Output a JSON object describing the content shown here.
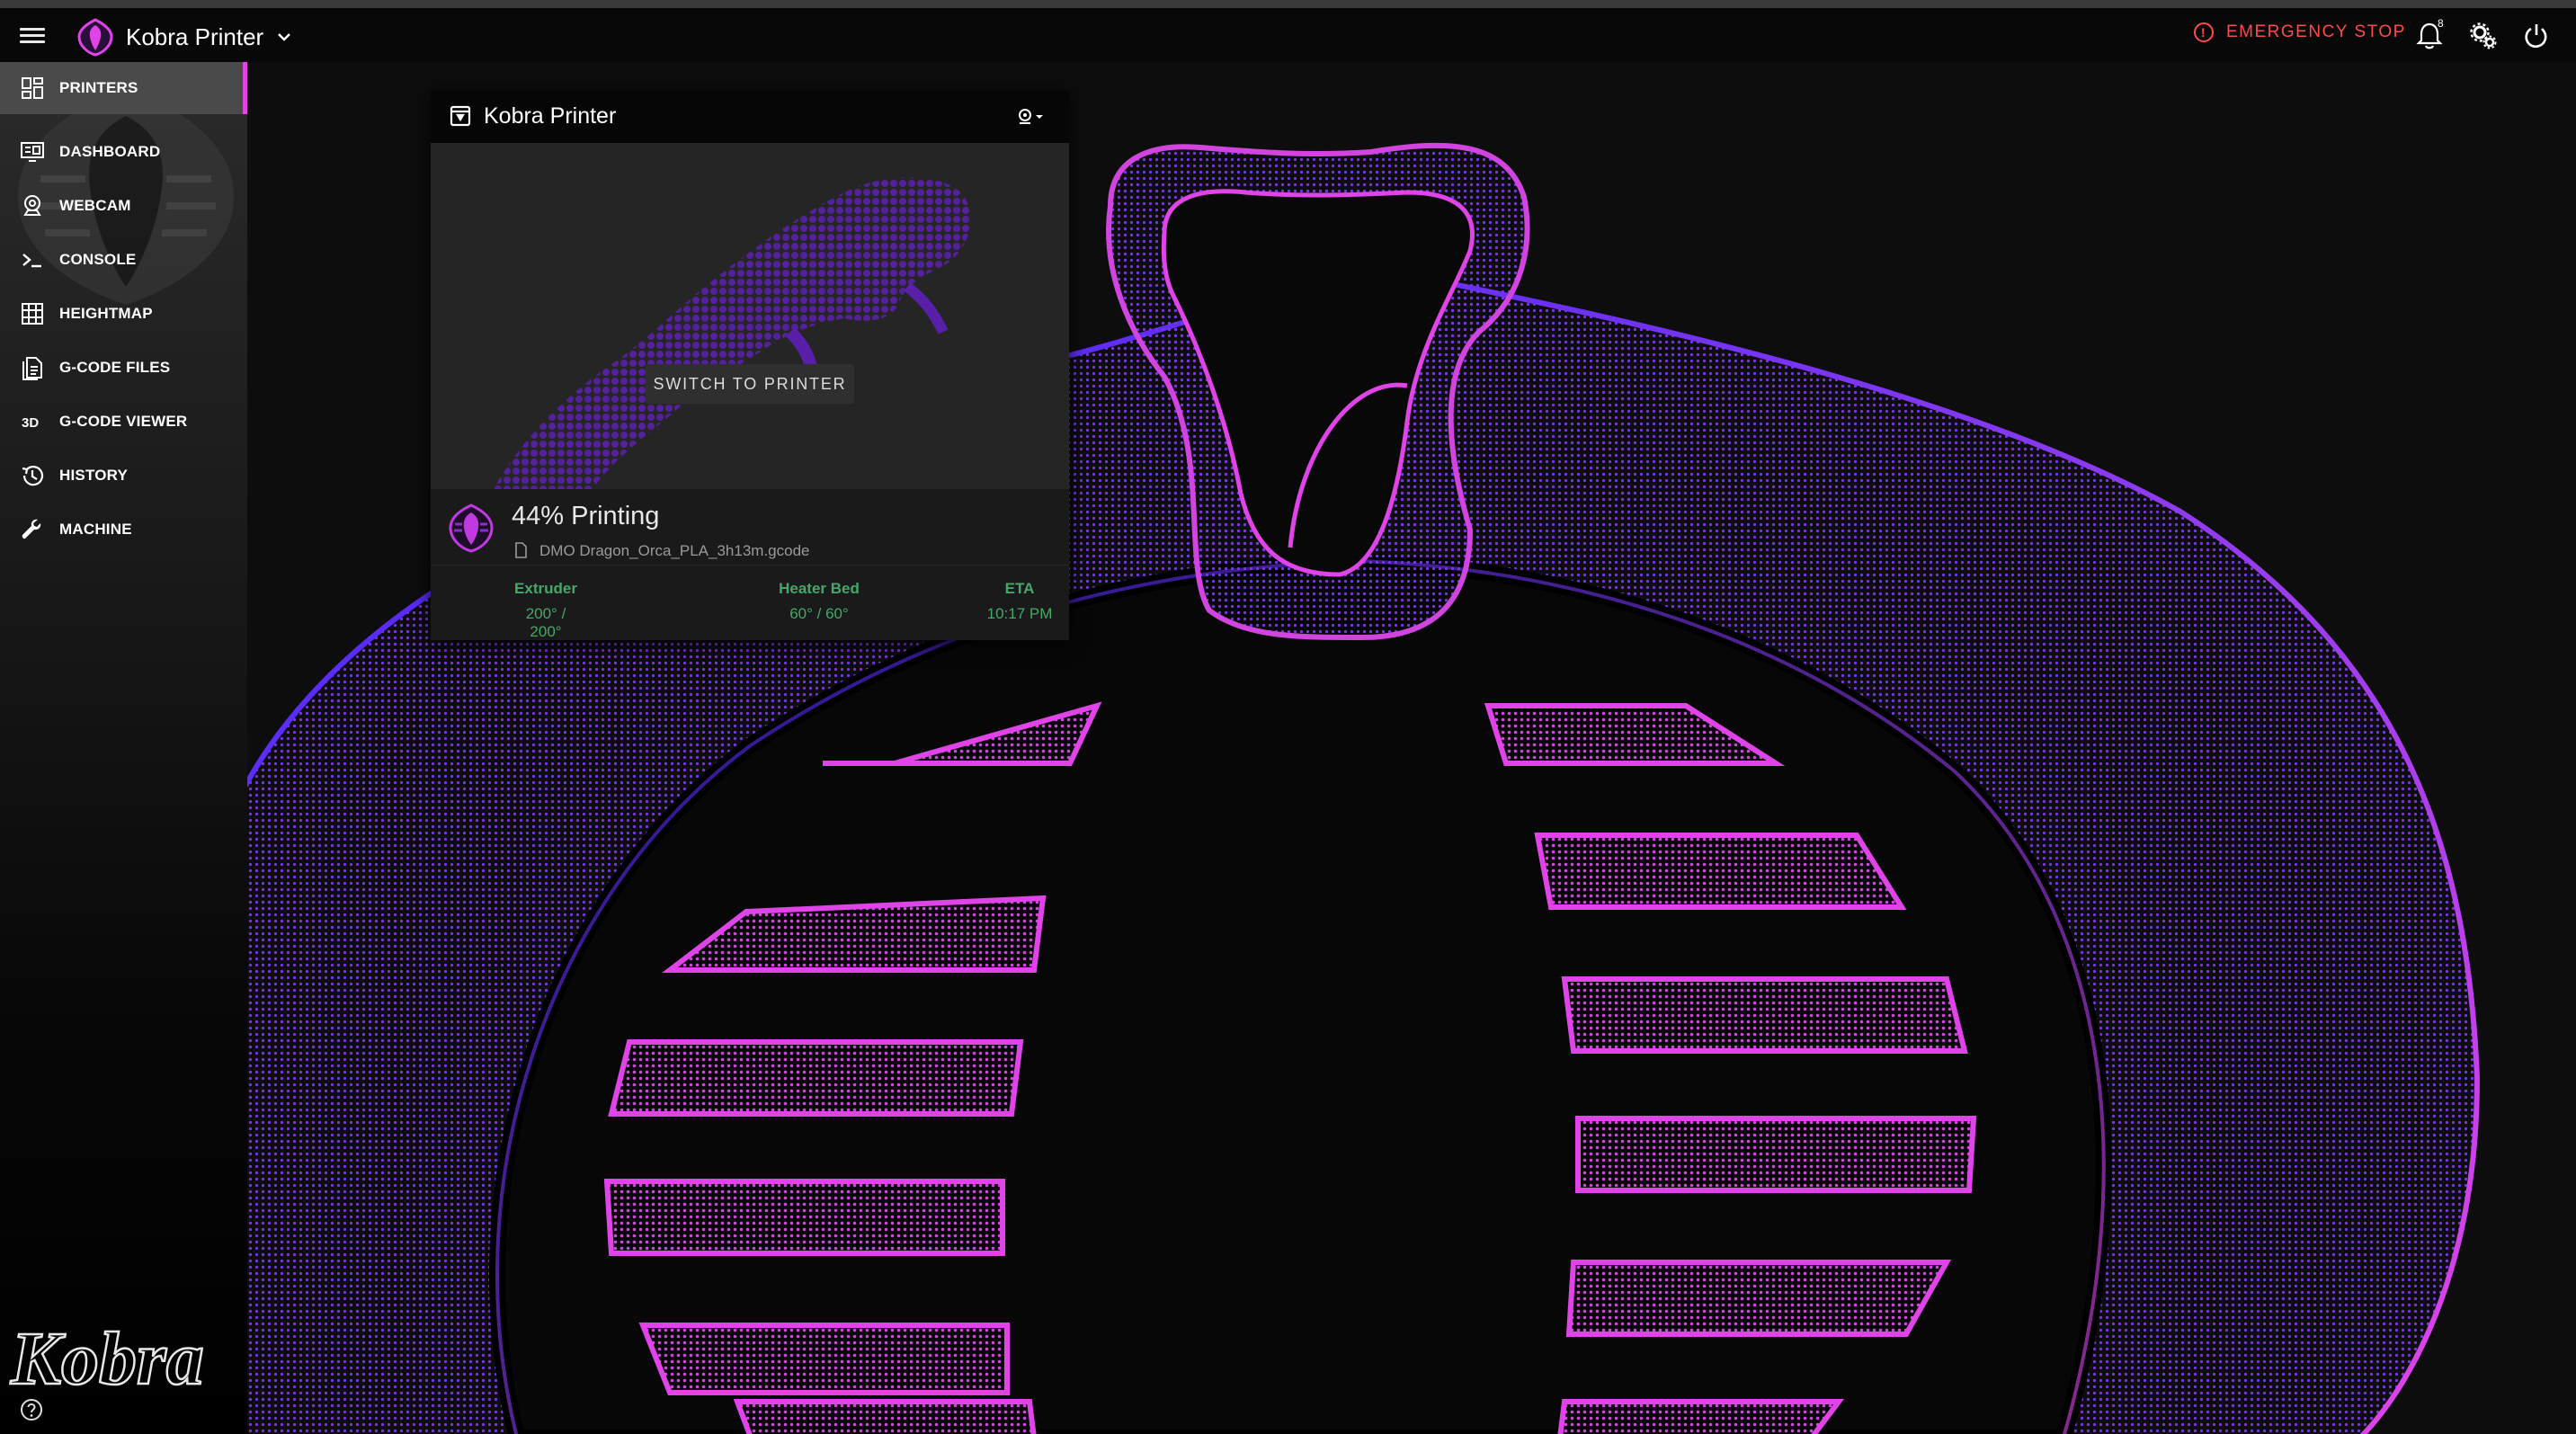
{
  "appbar": {
    "printer_name": "Kobra Printer",
    "emergency_stop_label": "EMERGENCY STOP",
    "notification_count": "8"
  },
  "sidebar": {
    "items": [
      {
        "label": "PRINTERS",
        "icon": "view-dashboard-icon",
        "active": true
      },
      {
        "label": "DASHBOARD",
        "icon": "monitor-dashboard-icon"
      },
      {
        "label": "WEBCAM",
        "icon": "webcam-icon"
      },
      {
        "label": "CONSOLE",
        "icon": "console-icon"
      },
      {
        "label": "HEIGHTMAP",
        "icon": "grid-icon"
      },
      {
        "label": "G-CODE FILES",
        "icon": "file-document-icon"
      },
      {
        "label": "G-CODE VIEWER",
        "icon": "3d-icon"
      },
      {
        "label": "HISTORY",
        "icon": "history-icon"
      },
      {
        "label": "MACHINE",
        "icon": "wrench-icon"
      }
    ],
    "brand_word": "Kobra"
  },
  "printer_card": {
    "title": "Kobra Printer",
    "switch_label": "SWITCH TO PRINTER",
    "progress_label": "44% Printing",
    "progress": 0.44,
    "filename": "DMO Dragon_Orca_PLA_3h13m.gcode",
    "stats": [
      {
        "label": "Extruder",
        "value": "200° / 200°"
      },
      {
        "label": "Heater Bed",
        "value": "60° / 60°"
      },
      {
        "label": "ETA",
        "value": "10:17 PM"
      }
    ]
  },
  "colors": {
    "accent": "#e044e8",
    "purple": "#5a2fd6",
    "danger": "#ff4a4a",
    "stat_green": "#45a86a"
  }
}
